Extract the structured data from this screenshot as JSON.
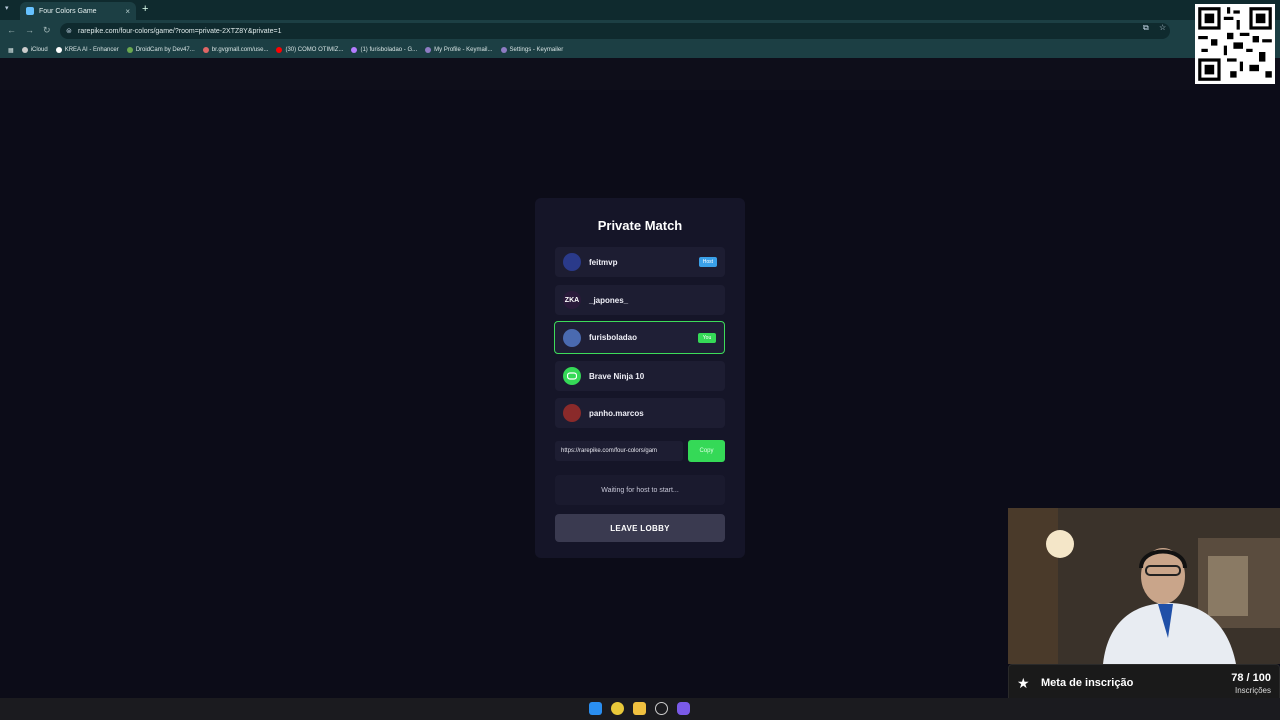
{
  "browser": {
    "tab_title": "Four Colors Game",
    "tab_close": "×",
    "new_tab": "+",
    "url": "rarepike.com/four-colors/game/?room=private-2XTZ8Y&private=1",
    "bookmarks": [
      {
        "label": "iCloud",
        "color": "#cccccc"
      },
      {
        "label": "KREA AI - Enhancer",
        "color": "#ffffff"
      },
      {
        "label": "DroidCam by Dev47...",
        "color": "#6aa84f"
      },
      {
        "label": "br.gvgmall.com/use...",
        "color": "#e06666"
      },
      {
        "label": "(30) COMO OTIMIZ...",
        "color": "#ff0000"
      },
      {
        "label": "(1) furisboladao - G...",
        "color": "#b47cff"
      },
      {
        "label": "My Profile - Keymail...",
        "color": "#8e7cc3"
      },
      {
        "label": "Settings - Keymailer",
        "color": "#8e7cc3"
      }
    ]
  },
  "lobby": {
    "title": "Private Match",
    "players": [
      {
        "name": "feitmvp",
        "avatar_text": "",
        "avatar_color": "#2a3a8a",
        "badge": "Host",
        "badge_type": "host",
        "is_me": false
      },
      {
        "name": "_japones_",
        "avatar_text": "ZKA",
        "avatar_color": "#2a1a3a",
        "badge": "",
        "badge_type": "",
        "is_me": false
      },
      {
        "name": "furisboladao",
        "avatar_text": "",
        "avatar_color": "#4a6ab0",
        "badge": "You",
        "badge_type": "you",
        "is_me": true
      },
      {
        "name": "Brave Ninja 10",
        "avatar_text": "",
        "avatar_color": "#35d957",
        "badge": "",
        "badge_type": "",
        "is_me": false
      },
      {
        "name": "panho.marcos",
        "avatar_text": "",
        "avatar_color": "#8a2a2a",
        "badge": "",
        "badge_type": "",
        "is_me": false
      }
    ],
    "invite_link": "https://rarepike.com/four-colors/gam",
    "copy_label": "Copy",
    "waiting_text": "Waiting for host to start...",
    "leave_label": "LEAVE LOBBY"
  },
  "subscription_goal": {
    "label": "Meta de inscrição",
    "count_text": "78 / 100",
    "unit": "Inscrições",
    "progress": 0.78,
    "milestones": [
      0.25,
      0.5,
      0.75
    ]
  }
}
